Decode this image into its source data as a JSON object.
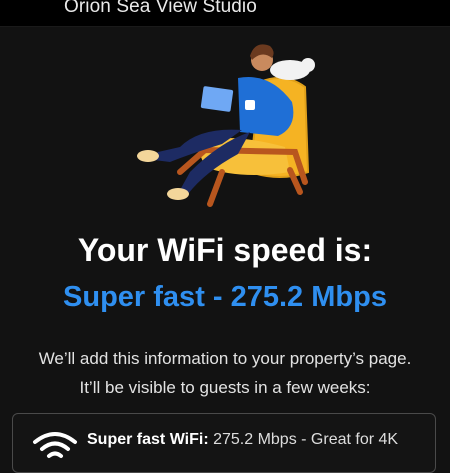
{
  "header": {
    "title": "Orion Sea View Studio"
  },
  "result": {
    "heading": "Your WiFi speed is:",
    "speed_text": "Super fast - 275.2 Mbps"
  },
  "info": {
    "line1": "We’ll add this information to your property’s page.",
    "line2": "It’ll be visible to guests in a few weeks:"
  },
  "card": {
    "icon": "wifi-icon",
    "label": "Super fast WiFi:",
    "detail": " 275.2 Mbps - Great for 4K"
  },
  "colors": {
    "accent": "#2f8ff0",
    "background": "#121212"
  }
}
